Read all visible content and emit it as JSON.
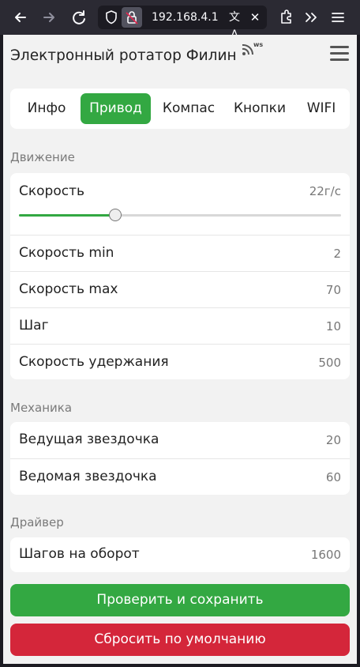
{
  "browser": {
    "url": "192.168.4.1"
  },
  "app": {
    "title": "Электронный ротатор Филин",
    "ws_badge": "ws"
  },
  "tabs": [
    {
      "label": "Инфо"
    },
    {
      "label": "Привод",
      "active": true
    },
    {
      "label": "Компас"
    },
    {
      "label": "Кнопки"
    },
    {
      "label": "WIFI"
    }
  ],
  "motion": {
    "heading": "Движение",
    "speed": {
      "label": "Скорость",
      "value": "22г/с",
      "slider_fraction": 0.3
    },
    "speed_min": {
      "label": "Скорость min",
      "value": "2"
    },
    "speed_max": {
      "label": "Скорость max",
      "value": "70"
    },
    "step": {
      "label": "Шаг",
      "value": "10"
    },
    "hold_speed": {
      "label": "Скорость удержания",
      "value": "500"
    }
  },
  "mechanics": {
    "heading": "Механика",
    "drive_sprocket": {
      "label": "Ведущая звездочка",
      "value": "20"
    },
    "driven_sprocket": {
      "label": "Ведомая звездочка",
      "value": "60"
    }
  },
  "driver": {
    "heading": "Драйвер",
    "steps_per_rev": {
      "label": "Шагов на оборот",
      "value": "1600"
    }
  },
  "actions": {
    "save_label": "Проверить и сохранить",
    "reset_label": "Сбросить по умолчанию"
  },
  "colors": {
    "accent": "#33a842",
    "danger": "#d4263a"
  }
}
